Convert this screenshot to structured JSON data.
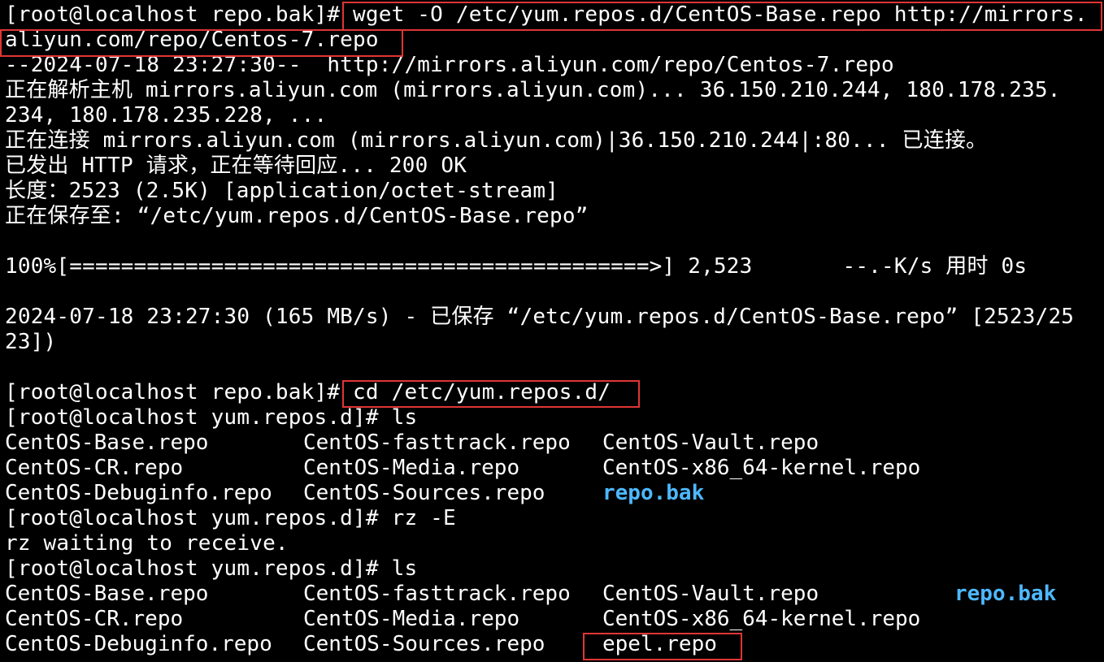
{
  "terminal": {
    "colors": {
      "background": "#000000",
      "text": "#ffffff",
      "directory": "#4db8ff",
      "highlight_box": "#e03535"
    },
    "prompt1": "[root@localhost repo.bak]#",
    "cmd_wget_part1": " wget -O /etc/yum.repos.d/CentOS-Base.repo http://mirrors.",
    "cmd_wget_part2": "aliyun.com/repo/Centos-7.repo",
    "wget_start": "--2024-07-18 23:27:30--  http://mirrors.aliyun.com/repo/Centos-7.repo",
    "resolving1": "正在解析主机 mirrors.aliyun.com (mirrors.aliyun.com)... 36.150.210.244, 180.178.235.",
    "resolving2": "234, 180.178.235.228, ...",
    "connecting": "正在连接 mirrors.aliyun.com (mirrors.aliyun.com)|36.150.210.244|:80... 已连接。",
    "http_request": "已发出 HTTP 请求，正在等待回应... 200 OK",
    "length": "长度：2523 (2.5K) [application/octet-stream]",
    "saving_to": "正在保存至: “/etc/yum.repos.d/CentOS-Base.repo”",
    "progress": "100%[=============================================>] 2,523       --.-K/s 用时 0s",
    "saved1": "2024-07-18 23:27:30 (165 MB/s) - 已保存 “/etc/yum.repos.d/CentOS-Base.repo” [2523/25",
    "saved2": "23])",
    "prompt2": "[root@localhost repo.bak]#",
    "cmd_cd": " cd /etc/yum.repos.d/",
    "prompt_ls1": "[root@localhost yum.repos.d]# ls",
    "ls1": [
      [
        "CentOS-Base.repo",
        "CentOS-fasttrack.repo",
        "CentOS-Vault.repo"
      ],
      [
        "CentOS-CR.repo",
        "CentOS-Media.repo",
        "CentOS-x86_64-kernel.repo"
      ],
      [
        "CentOS-Debuginfo.repo",
        "CentOS-Sources.repo",
        "repo.bak"
      ]
    ],
    "prompt_rz": "[root@localhost yum.repos.d]# rz -E",
    "rz_waiting": "rz waiting to receive.",
    "prompt_ls2": "[root@localhost yum.repos.d]# ls",
    "ls2": [
      [
        "CentOS-Base.repo",
        "CentOS-fasttrack.repo",
        "CentOS-Vault.repo",
        "repo.bak"
      ],
      [
        "CentOS-CR.repo",
        "CentOS-Media.repo",
        "CentOS-x86_64-kernel.repo",
        ""
      ],
      [
        "CentOS-Debuginfo.repo",
        "CentOS-Sources.repo",
        "epel.repo",
        ""
      ]
    ]
  }
}
